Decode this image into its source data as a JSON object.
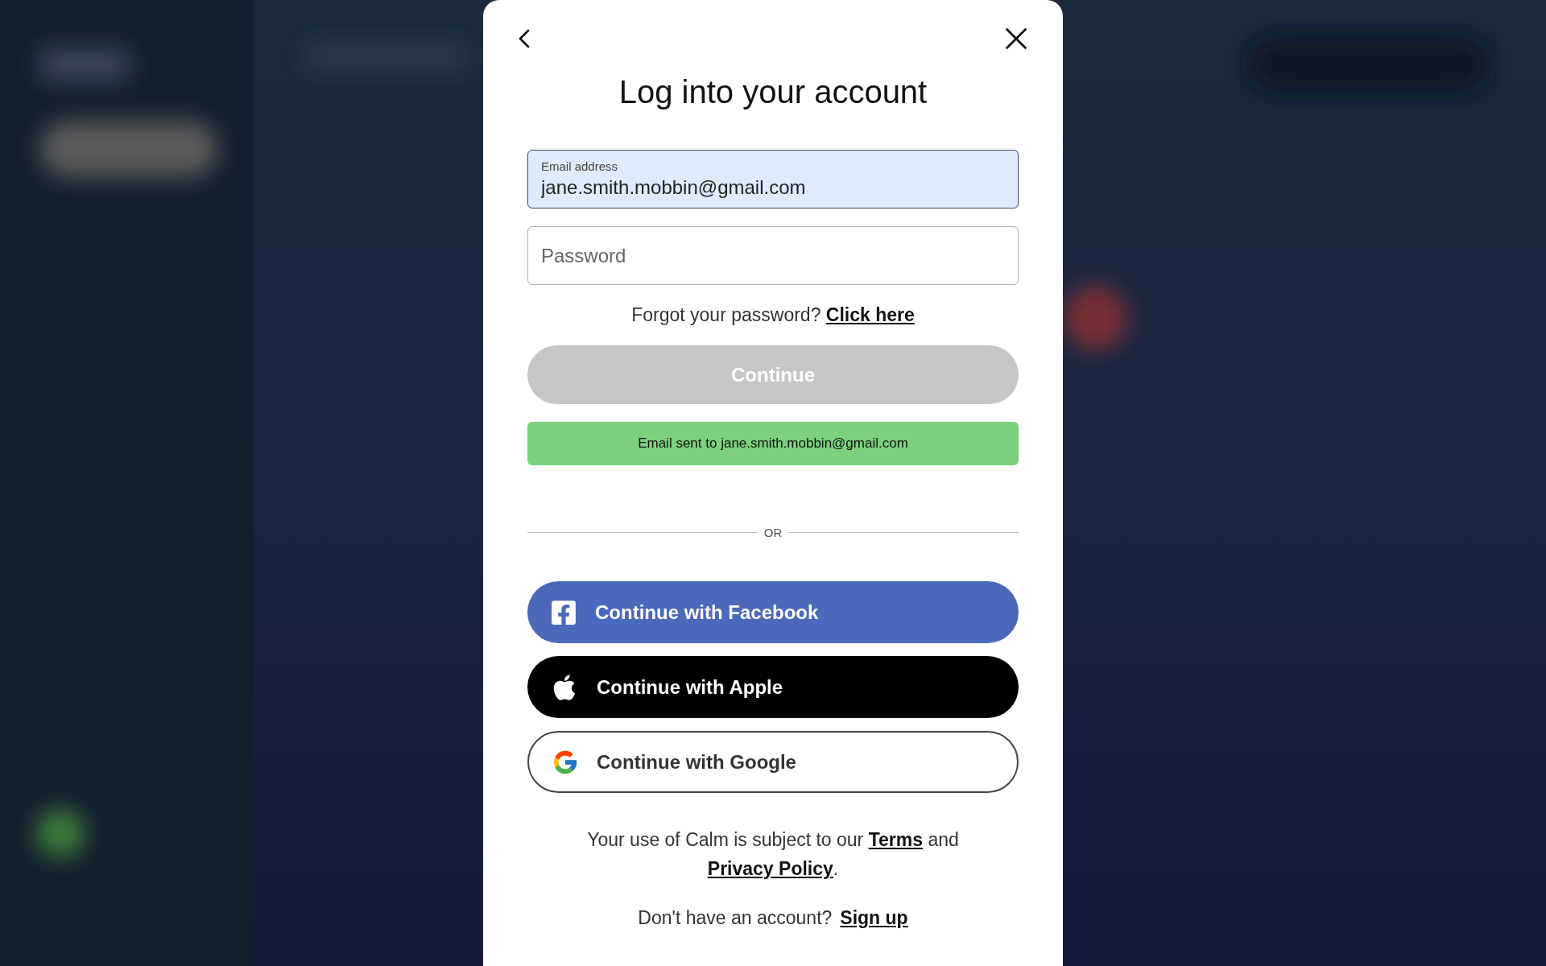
{
  "title": "Log into your account",
  "email_field": {
    "label": "Email address",
    "value": "jane.smith.mobbin@gmail.com",
    "focused": true
  },
  "password_field": {
    "placeholder": "Password"
  },
  "forgot": {
    "text": "Forgot your password?",
    "link": "Click here"
  },
  "continue_button": {
    "label": "Continue",
    "disabled": true
  },
  "notice": {
    "text": "Email sent to jane.smith.mobbin@gmail.com"
  },
  "divider_label": "OR",
  "social_buttons": [
    {
      "kind": "facebook",
      "label": "Continue with Facebook"
    },
    {
      "kind": "apple",
      "label": "Continue with Apple"
    },
    {
      "kind": "google",
      "label": "Continue with Google"
    }
  ],
  "legal": [
    {
      "text": "Your use of Calm is subject to our ",
      "link": false
    },
    {
      "text": "Terms",
      "link": true
    },
    {
      "text": " and ",
      "link": false
    },
    {
      "text": "Privacy Policy",
      "link": true
    },
    {
      "text": ".",
      "link": false
    }
  ],
  "signup": {
    "text": "Don't have an account?",
    "link": "Sign up"
  }
}
